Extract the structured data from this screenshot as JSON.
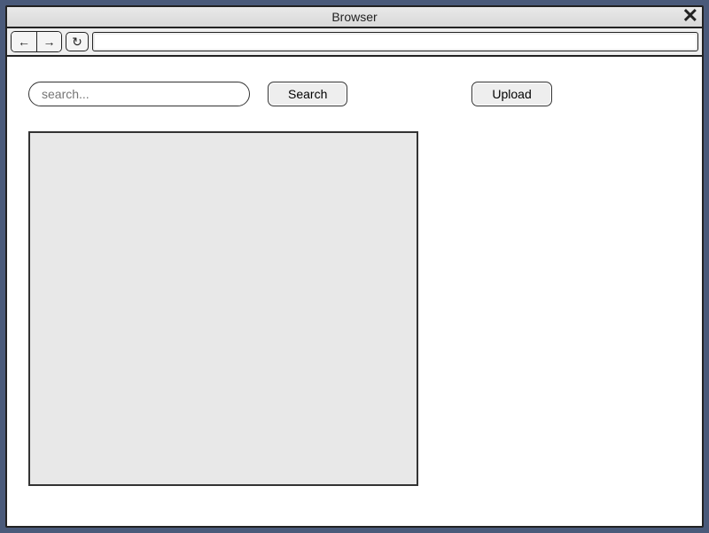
{
  "window": {
    "title": "Browser",
    "close_glyph": "✕"
  },
  "toolbar": {
    "back_glyph": "←",
    "forward_glyph": "→",
    "reload_glyph": "↻",
    "url_value": ""
  },
  "main": {
    "search_placeholder": "search...",
    "search_value": "",
    "search_button_label": "Search",
    "upload_button_label": "Upload"
  }
}
